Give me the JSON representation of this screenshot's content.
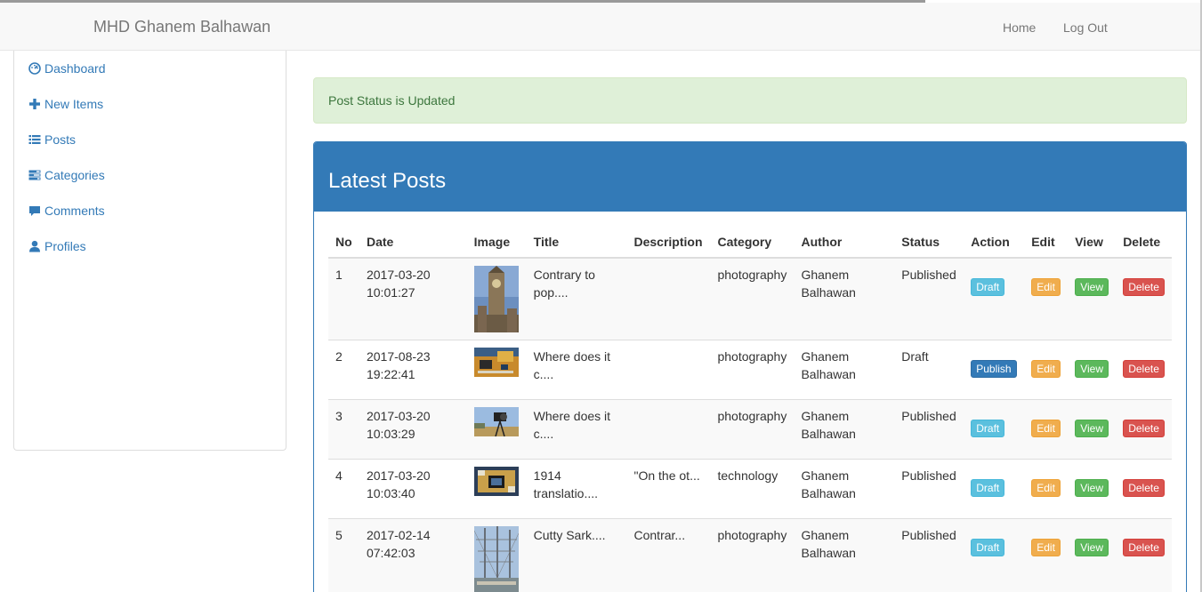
{
  "navbar": {
    "brand": "MHD Ghanem Balhawan",
    "home": "Home",
    "logout": "Log Out"
  },
  "sidebar": {
    "items": [
      {
        "label": "Dashboard",
        "icon": "dashboard-icon"
      },
      {
        "label": "New Items",
        "icon": "plus-icon"
      },
      {
        "label": "Posts",
        "icon": "list-icon"
      },
      {
        "label": "Categories",
        "icon": "tasks-icon"
      },
      {
        "label": "Comments",
        "icon": "comment-icon"
      },
      {
        "label": "Profiles",
        "icon": "user-icon"
      }
    ]
  },
  "alert": {
    "text": "Post Status is Updated"
  },
  "panel": {
    "title": "Latest Posts",
    "columns": [
      "No",
      "Date",
      "Image",
      "Title",
      "Description",
      "Category",
      "Author",
      "Status",
      "Action",
      "Edit",
      "View",
      "Delete"
    ],
    "rows": [
      {
        "no": "1",
        "date1": "2017-03-20",
        "date2": "10:01:27",
        "title1": "Contrary to",
        "title2": "pop....",
        "description": "",
        "category": "photography",
        "author1": "Ghanem",
        "author2": "Balhawan",
        "status": "Published",
        "action": "Draft",
        "edit": "Edit",
        "view": "View",
        "delete": "Delete"
      },
      {
        "no": "2",
        "date1": "2017-08-23",
        "date2": "19:22:41",
        "title1": "Where does it",
        "title2": "c....",
        "description": "",
        "category": "photography",
        "author1": "Ghanem",
        "author2": "Balhawan",
        "status": "Draft",
        "action": "Publish",
        "edit": "Edit",
        "view": "View",
        "delete": "Delete"
      },
      {
        "no": "3",
        "date1": "2017-03-20",
        "date2": "10:03:29",
        "title1": "Where does it",
        "title2": "c....",
        "description": "",
        "category": "photography",
        "author1": "Ghanem",
        "author2": "Balhawan",
        "status": "Published",
        "action": "Draft",
        "edit": "Edit",
        "view": "View",
        "delete": "Delete"
      },
      {
        "no": "4",
        "date1": "2017-03-20",
        "date2": "10:03:40",
        "title1": "1914",
        "title2": "translatio....",
        "description": "\"On the ot...",
        "category": "technology",
        "author1": "Ghanem",
        "author2": "Balhawan",
        "status": "Published",
        "action": "Draft",
        "edit": "Edit",
        "view": "View",
        "delete": "Delete"
      },
      {
        "no": "5",
        "date1": "2017-02-14",
        "date2": "07:42:03",
        "title1": "Cutty Sark....",
        "title2": "",
        "description": "Contrar...",
        "category": "photography",
        "author1": "Ghanem",
        "author2": "Balhawan",
        "status": "Published",
        "action": "Draft",
        "edit": "Edit",
        "view": "View",
        "delete": "Delete"
      }
    ]
  },
  "colors": {
    "primary": "#337ab7",
    "info": "#5bc0de",
    "warning": "#f0ad4e",
    "success": "#5cb85c",
    "danger": "#d9534f",
    "alert_bg": "#dff0d8"
  }
}
